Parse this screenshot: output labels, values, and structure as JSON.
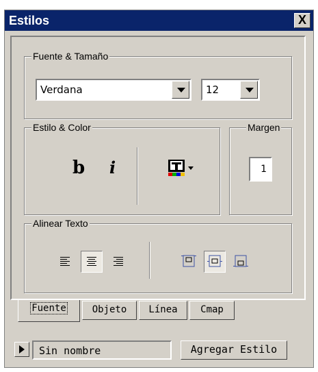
{
  "window": {
    "title": "Estilos",
    "close_label": "X"
  },
  "font_group": {
    "label": "Fuente & Tamaño",
    "font_value": "Verdana",
    "size_value": "12"
  },
  "style_group": {
    "label": "Estilo & Color",
    "bold_label": "b",
    "italic_label": "i",
    "color_icon": "text-color-icon"
  },
  "margin_group": {
    "label": "Margen",
    "value": "1"
  },
  "align_group": {
    "label": "Alinear Texto",
    "text_align_icons": [
      "align-left-icon",
      "align-center-icon",
      "align-right-icon"
    ],
    "selected_text_align": "align-center-icon",
    "box_align_icons": [
      "box-align-top-icon",
      "box-align-middle-icon",
      "box-align-bottom-icon"
    ],
    "selected_box_align": "box-align-middle-icon"
  },
  "tabs": [
    {
      "label": "Fuente",
      "active": true
    },
    {
      "label": "Objeto",
      "active": false
    },
    {
      "label": "Línea",
      "active": false
    },
    {
      "label": "Cmap",
      "active": false
    }
  ],
  "footer": {
    "style_name": "Sin nombre",
    "add_style_label": "Agregar Estilo"
  },
  "colors": {
    "titlebar": "#0a246a",
    "face": "#d4d0c8",
    "accent_blue": "#3c52a4"
  }
}
